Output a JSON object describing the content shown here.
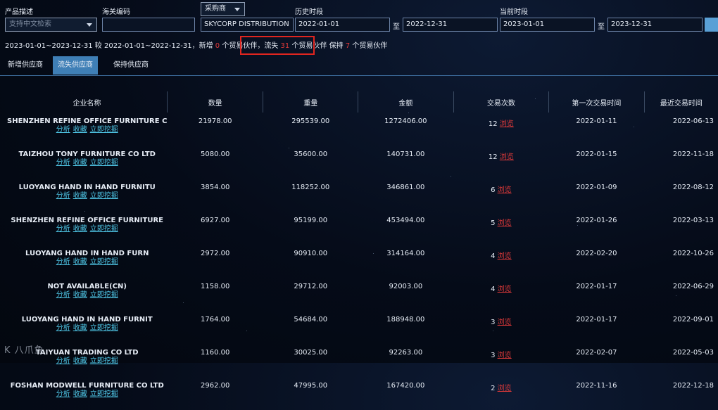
{
  "filters": {
    "product_label": "产品描述",
    "product_placeholder": "支持中文检索",
    "hs_label": "海关编码",
    "hs_value": "",
    "role_select": "采购商",
    "company_value": "SKYCORP DISTRIBUTION",
    "history_label": "历史时段",
    "history_start": "2022-01-01",
    "history_end": "2022-12-31",
    "current_label": "当前时段",
    "current_start": "2023-01-01",
    "current_end": "2023-12-31",
    "to": "至"
  },
  "summary": {
    "prefix": "2023-01-01~2023-12-31 较 2022-01-01~2022-12-31，新增",
    "new_count": "0",
    "mid1": "个贸易伙伴，流失",
    "lost_count": "31",
    "mid2": "个贸易伙伴",
    "keep_label": "保持",
    "keep_count": "7",
    "suffix": "个贸易伙伴"
  },
  "tabs": [
    "新增供应商",
    "流失供应商",
    "保持供应商"
  ],
  "table": {
    "headers": [
      "企业名称",
      "数量",
      "重量",
      "金额",
      "交易次数",
      "第一次交易时间",
      "最近交易时间"
    ],
    "action_labels": [
      "分析",
      "收藏",
      "立即挖掘"
    ],
    "browse_label": "浏览",
    "rows": [
      {
        "name": "SHENZHEN REFINE OFFICE FURNITURE C",
        "qty": "21978.00",
        "weight": "295539.00",
        "amount": "1272406.00",
        "count": "12",
        "first": "2022-01-11",
        "last": "2022-06-13"
      },
      {
        "name": "TAIZHOU TONY FURNITURE CO LTD",
        "qty": "5080.00",
        "weight": "35600.00",
        "amount": "140731.00",
        "count": "12",
        "first": "2022-01-15",
        "last": "2022-11-18"
      },
      {
        "name": "LUOYANG HAND IN HAND FURNITU",
        "qty": "3854.00",
        "weight": "118252.00",
        "amount": "346861.00",
        "count": "6",
        "first": "2022-01-09",
        "last": "2022-08-12"
      },
      {
        "name": "SHENZHEN REFINE OFFICE FURNITURE",
        "qty": "6927.00",
        "weight": "95199.00",
        "amount": "453494.00",
        "count": "5",
        "first": "2022-01-26",
        "last": "2022-03-13"
      },
      {
        "name": "LUOYANG HAND IN HAND FURN",
        "qty": "2972.00",
        "weight": "90910.00",
        "amount": "314164.00",
        "count": "4",
        "first": "2022-02-20",
        "last": "2022-10-26"
      },
      {
        "name": "NOT AVAILABLE(CN)",
        "qty": "1158.00",
        "weight": "29712.00",
        "amount": "92003.00",
        "count": "4",
        "first": "2022-01-17",
        "last": "2022-06-29"
      },
      {
        "name": "LUOYANG HAND IN HAND FURNIT",
        "qty": "1764.00",
        "weight": "54684.00",
        "amount": "188948.00",
        "count": "3",
        "first": "2022-01-17",
        "last": "2022-09-01"
      },
      {
        "name": "TAIYUAN TRADING CO LTD",
        "qty": "1160.00",
        "weight": "30025.00",
        "amount": "92263.00",
        "count": "3",
        "first": "2022-02-07",
        "last": "2022-05-03"
      },
      {
        "name": "FOSHAN MODWELL FURNITURE CO LTD",
        "qty": "2962.00",
        "weight": "47995.00",
        "amount": "167420.00",
        "count": "2",
        "first": "2022-11-16",
        "last": "2022-12-18"
      }
    ]
  },
  "watermark": "K 八爪鱼"
}
